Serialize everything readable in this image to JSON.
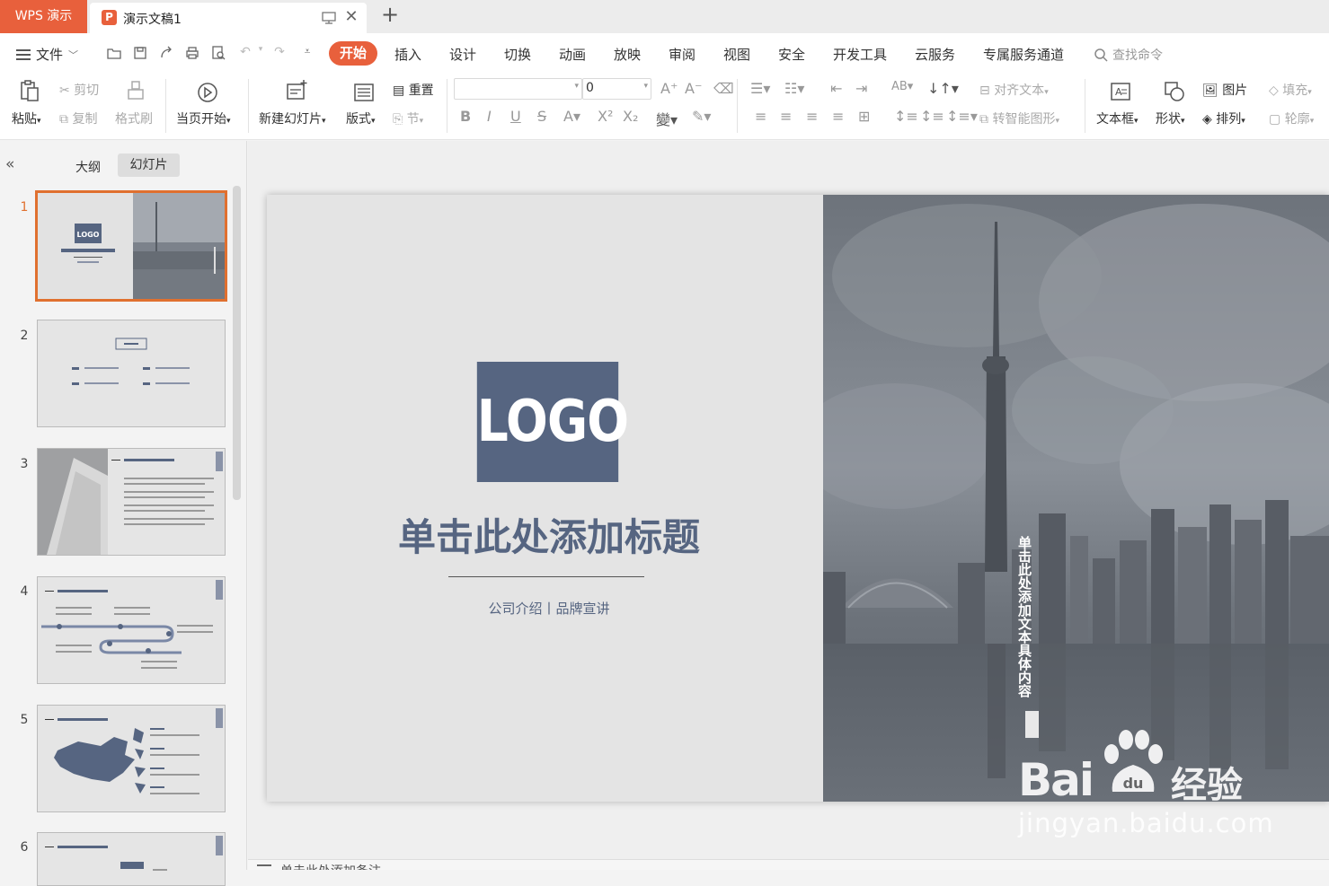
{
  "titlebar": {
    "app_name": "WPS 演示",
    "doc_title": "演示文稿1",
    "new_tab": "+",
    "close": "✕"
  },
  "menubar": {
    "file": "文件",
    "tabs": [
      "开始",
      "插入",
      "设计",
      "切换",
      "动画",
      "放映",
      "审阅",
      "视图",
      "安全",
      "开发工具",
      "云服务",
      "专属服务通道"
    ],
    "active_tab": "开始",
    "search_placeholder": "查找命令"
  },
  "ribbon": {
    "paste": "粘贴",
    "cut": "剪切",
    "copy": "复制",
    "format_painter": "格式刷",
    "start_from_current": "当页开始",
    "new_slide": "新建幻灯片",
    "layout": "版式",
    "reset": "重置",
    "section": "节",
    "font_size": "0",
    "align_text": "对齐文本",
    "smart_art": "转智能图形",
    "textbox": "文本框",
    "shape": "形状",
    "picture": "图片",
    "arrange": "排列",
    "fill": "填充",
    "outline": "轮廓"
  },
  "sidepanel": {
    "tab_outline": "大纲",
    "tab_slides": "幻灯片",
    "slide_numbers": [
      "1",
      "2",
      "3",
      "4",
      "5",
      "6"
    ]
  },
  "slide": {
    "logo": "LOGO",
    "title": "单击此处添加标题",
    "subtitle": "公司介绍丨品牌宣讲",
    "vertical_text": "单击此处添加文本具体内容"
  },
  "watermark": {
    "brand": "Bai",
    "brand2": "经验",
    "url": "jingyan.baidu.com"
  },
  "notes": {
    "placeholder": "单击此处添加备注"
  },
  "colors": {
    "accent": "#e8603c",
    "slide_blue": "#566581"
  }
}
